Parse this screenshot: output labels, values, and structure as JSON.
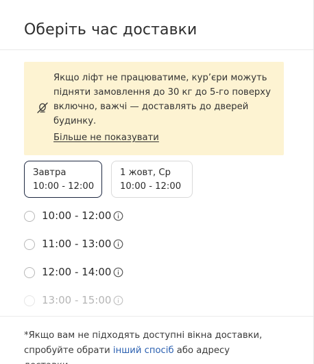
{
  "header": {
    "title": "Оберіть час доставки"
  },
  "notice": {
    "icon": "no-elevator-icon",
    "text": "Якщо ліфт не працюватиме, кур’єри можуть підняти замовлення до 30 кг до 5-го поверху включно, важчі — доставлять до дверей будинку.",
    "dismiss_label": "Більше не показувати"
  },
  "days": [
    {
      "label": "Завтра",
      "hours": "10:00 - 12:00",
      "selected": true
    },
    {
      "label": "1 жовт, Ср",
      "hours": "10:00 - 12:00",
      "selected": false
    }
  ],
  "slots": [
    {
      "time": "10:00 - 12:00",
      "info_icon": "info-icon"
    },
    {
      "time": "11:00 - 13:00",
      "info_icon": "info-icon"
    },
    {
      "time": "12:00 - 14:00",
      "info_icon": "info-icon"
    },
    {
      "time": "13:00 - 15:00",
      "info_icon": "info-icon"
    }
  ],
  "footer": {
    "text_before": "*Якщо вам не підходять доступні вікна доставки, спробуйте обрати ",
    "link": "інший спосіб",
    "text_after": " або адресу доставки"
  },
  "colors": {
    "notice_bg": "#fdf3d2",
    "link": "#2a5fb0",
    "active_border": "#1c2740"
  }
}
